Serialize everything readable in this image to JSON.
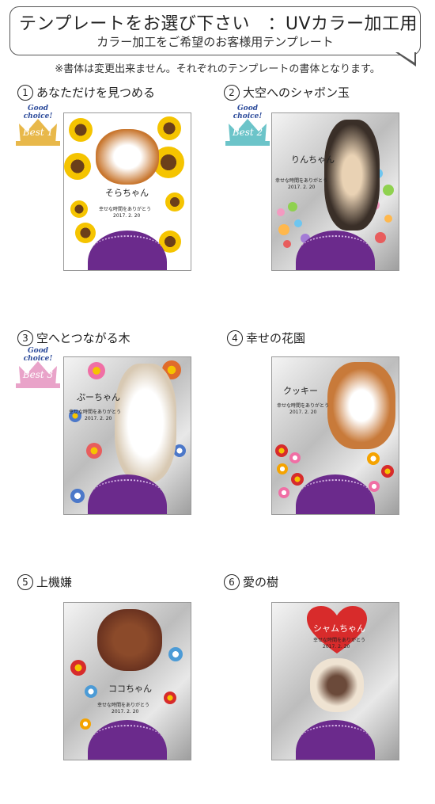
{
  "header": {
    "title": "テンプレートをお選び下さい　：UVカラー加工用",
    "subtitle": "カラー加工をご希望のお客様用テンプレート",
    "note": "※書体は変更出来ません。それぞれのテンプレートの書体となります。"
  },
  "badges": {
    "good_choice": "Good choice!",
    "best1": "Best 1",
    "best2": "Best 2",
    "best3": "Best 3"
  },
  "templates": [
    {
      "num": "1",
      "title": "あなただけを見つめる",
      "pet_name": "そらちゃん",
      "message": "幸せな時間をありがとう",
      "date": "2017. 2. 20"
    },
    {
      "num": "2",
      "title": "大空へのシャボン玉",
      "pet_name": "りんちゃん",
      "message": "幸せな時間をありがとう",
      "date": "2017. 2. 20"
    },
    {
      "num": "3",
      "title": "空へとつながる木",
      "pet_name": "ぷーちゃん",
      "message": "幸せな時間をありがとう",
      "date": "2017. 2. 20"
    },
    {
      "num": "4",
      "title": "幸せの花園",
      "pet_name": "クッキー",
      "message": "幸せな時間をありがとう",
      "date": "2017. 2. 20"
    },
    {
      "num": "5",
      "title": "上機嫌",
      "pet_name": "ココちゃん",
      "message": "幸せな時間をありがとう",
      "date": "2017. 2. 20"
    },
    {
      "num": "6",
      "title": "愛の樹",
      "pet_name": "シャムちゃん",
      "message": "幸せな時間をありがとう",
      "date": "2017. 2. 20"
    }
  ],
  "colors": {
    "arc_purple": "#6b2a8c",
    "badge_gold": "#e8b84a",
    "badge_teal": "#6cc4c9",
    "badge_pink": "#e9a3c9",
    "heart_red": "#d82b2b"
  }
}
